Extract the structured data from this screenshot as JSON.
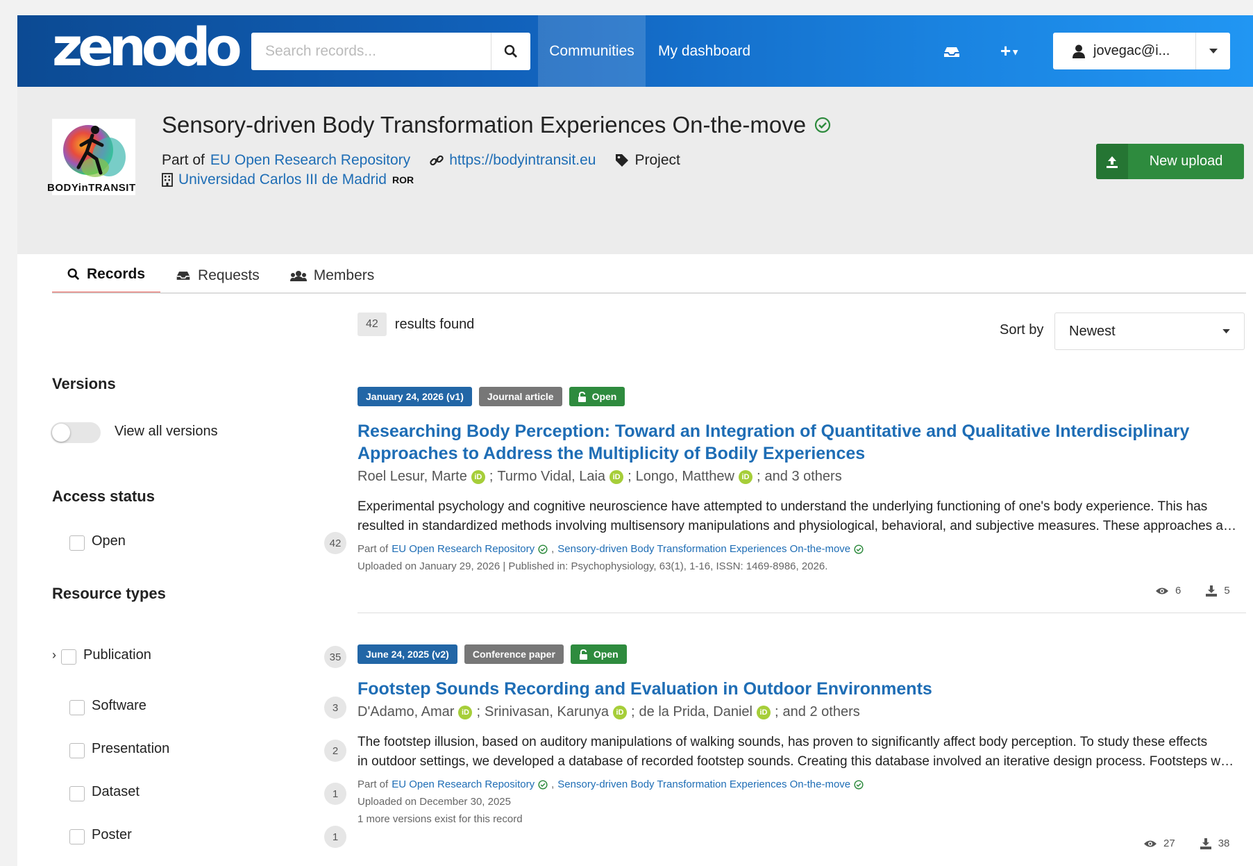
{
  "header": {
    "logo_text": "zenodo",
    "search_placeholder": "Search records...",
    "nav": [
      "Communities",
      "My dashboard"
    ],
    "user_label": "jovegac@i..."
  },
  "community": {
    "logo_caption": "BODYinTRANSIT",
    "title": "Sensory-driven Body Transformation Experiences On-the-move",
    "part_of_prefix": "Part of",
    "part_of_link": "EU Open Research Repository",
    "website": "https://bodyintransit.eu",
    "type": "Project",
    "organization": "Universidad Carlos III de Madrid",
    "ror_label": "ROR",
    "new_upload": "New upload",
    "tabs": [
      "Records",
      "Requests",
      "Members"
    ]
  },
  "facets": {
    "versions_title": "Versions",
    "view_all_versions": "View all versions",
    "access_title": "Access status",
    "access": [
      {
        "label": "Open",
        "count": "42"
      }
    ],
    "resource_title": "Resource types",
    "resource_types": [
      {
        "label": "Publication",
        "count": "35"
      },
      {
        "label": "Software",
        "count": "3"
      },
      {
        "label": "Presentation",
        "count": "2"
      },
      {
        "label": "Dataset",
        "count": "1"
      },
      {
        "label": "Poster",
        "count": "1"
      }
    ]
  },
  "results": {
    "count": "42",
    "count_label": "results found",
    "sort_label": "Sort by",
    "sort_value": "Newest"
  },
  "records": [
    {
      "date_badge": "January 24, 2026 (v1)",
      "type_badge": "Journal article",
      "access_badge": "Open",
      "title": "Researching Body Perception: Toward an Integration of Quantitative and Qualitative Interdisciplinary Approaches to Address the Multiplicity of Bodily Experiences",
      "authors": [
        "Roel Lesur, Marte",
        "Turmo Vidal, Laia",
        "Longo, Matthew"
      ],
      "others": "and 3 others",
      "desc_line1": "Experimental psychology and cognitive neuroscience have attempted to understand the underlying functioning of one's body experience. This has",
      "desc_line2": "resulted in standardized methods involving multisensory manipulations and physiological, behavioral, and subjective measures. These approaches are useful",
      "part_of_prefix": "Part of",
      "part_of_links": [
        "EU Open Research Repository",
        "Sensory-driven Body Transformation Experiences On-the-move"
      ],
      "uploaded": "Uploaded on January 29, 2026 | Published in: Psychophysiology, 63(1), 1-16, ISSN: 1469-8986, 2026.",
      "views": "6",
      "downloads": "5"
    },
    {
      "date_badge": "June 24, 2025 (v2)",
      "type_badge": "Conference paper",
      "access_badge": "Open",
      "title": "Footstep Sounds Recording and Evaluation in Outdoor Environments",
      "authors": [
        "D'Adamo, Amar",
        "Srinivasan, Karunya",
        "de la Prida, Daniel"
      ],
      "others": "and 2 others",
      "desc_line1": "The footstep illusion, based on auditory manipulations of walking sounds, has proven to significantly affect body perception. To study these effects",
      "desc_line2": "in outdoor settings, we developed a database of recorded footstep sounds. Creating this database involved an iterative design process. Footsteps were",
      "part_of_prefix": "Part of",
      "part_of_links": [
        "EU Open Research Repository",
        "Sensory-driven Body Transformation Experiences On-the-move"
      ],
      "uploaded": "Uploaded on December 30, 2025",
      "versions_note": "1 more versions exist for this record",
      "views": "27",
      "downloads": "38"
    }
  ]
}
